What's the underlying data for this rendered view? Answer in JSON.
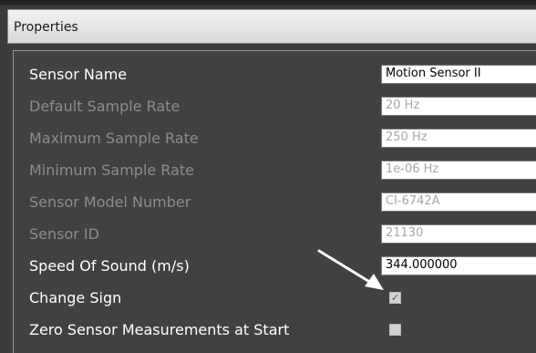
{
  "window": {
    "title": "Properties"
  },
  "properties": [
    {
      "label": "Sensor Name",
      "value": "Motion Sensor II",
      "enabled": true,
      "type": "text"
    },
    {
      "label": "Default Sample Rate",
      "value": "20 Hz",
      "enabled": false,
      "type": "text"
    },
    {
      "label": "Maximum Sample Rate",
      "value": "250 Hz",
      "enabled": false,
      "type": "text"
    },
    {
      "label": "Minimum Sample Rate",
      "value": "1e-06 Hz",
      "enabled": false,
      "type": "text"
    },
    {
      "label": "Sensor Model Number",
      "value": "CI-6742A",
      "enabled": false,
      "type": "text"
    },
    {
      "label": "Sensor ID",
      "value": "21130",
      "enabled": false,
      "type": "text"
    },
    {
      "label": "Speed Of Sound (m/s)",
      "value": "344.000000",
      "enabled": true,
      "type": "text"
    },
    {
      "label": "Change Sign",
      "checked": true,
      "check_glyph": "✓",
      "enabled": true,
      "type": "checkbox"
    },
    {
      "label": "Zero Sensor Measurements at Start",
      "checked": false,
      "check_glyph": "",
      "enabled": true,
      "type": "checkbox"
    }
  ],
  "annotation": {
    "icon": "arrow-pointer-icon",
    "color": "#ffffff"
  }
}
